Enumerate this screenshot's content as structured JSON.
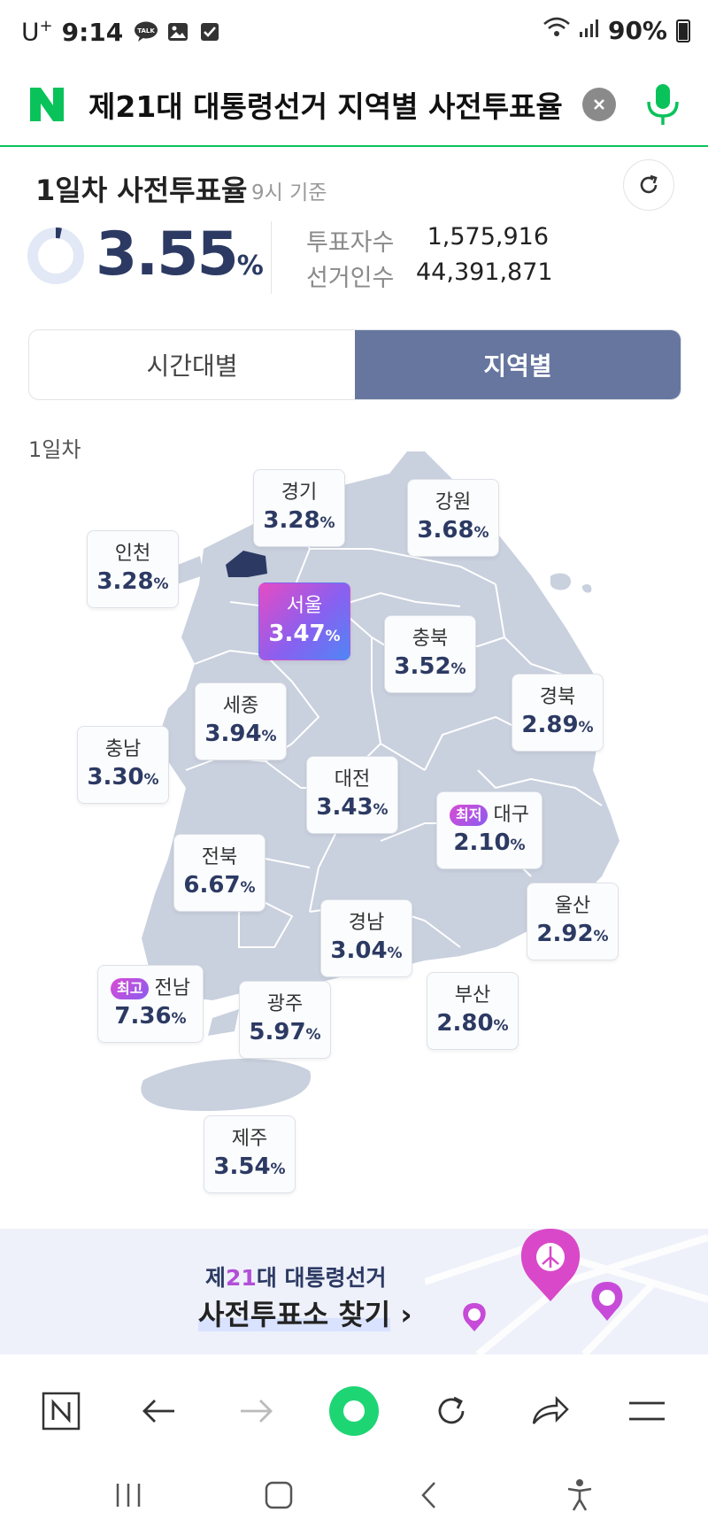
{
  "status_bar": {
    "carrier": "U",
    "carrier_sup": "+",
    "time": "9:14",
    "icons": [
      "talk-icon",
      "gallery-icon",
      "checkbox-icon"
    ],
    "battery": "90%"
  },
  "search": {
    "query": "제21대 대통령선거 지역별 사전투표율",
    "logo": "N"
  },
  "summary": {
    "title": "1일차 사전투표율",
    "basis": "9시 기준",
    "rate_value": "3.55",
    "rate_unit": "%",
    "voters_label": "투표자수",
    "voters_value": "1,575,916",
    "electorate_label": "선거인수",
    "electorate_value": "44,391,871"
  },
  "tabs": [
    {
      "label": "시간대별",
      "active": false
    },
    {
      "label": "지역별",
      "active": true
    }
  ],
  "map": {
    "day_label": "1일차",
    "regions": {
      "gyeonggi": {
        "name": "경기",
        "value": "3.28"
      },
      "gangwon": {
        "name": "강원",
        "value": "3.68"
      },
      "incheon": {
        "name": "인천",
        "value": "3.28"
      },
      "seoul": {
        "name": "서울",
        "value": "3.47"
      },
      "chungbuk": {
        "name": "충북",
        "value": "3.52"
      },
      "gyeongbuk": {
        "name": "경북",
        "value": "2.89"
      },
      "sejong": {
        "name": "세종",
        "value": "3.94"
      },
      "chungnam": {
        "name": "충남",
        "value": "3.30"
      },
      "daejeon": {
        "name": "대전",
        "value": "3.43"
      },
      "daegu": {
        "name": "대구",
        "value": "2.10",
        "badge": "최저"
      },
      "jeonbuk": {
        "name": "전북",
        "value": "6.67"
      },
      "ulsan": {
        "name": "울산",
        "value": "2.92"
      },
      "gyeongnam": {
        "name": "경남",
        "value": "3.04"
      },
      "jeonnam": {
        "name": "전남",
        "value": "7.36",
        "badge": "최고"
      },
      "gwangju": {
        "name": "광주",
        "value": "5.97"
      },
      "busan": {
        "name": "부산",
        "value": "2.80"
      },
      "jeju": {
        "name": "제주",
        "value": "3.54"
      }
    },
    "unit": "%",
    "colors": {
      "map_fill": "#c9d0de",
      "seoul_fill": "#2c3a63",
      "value_text": "#2c3a63"
    }
  },
  "banner": {
    "line1_prefix": "제",
    "line1_num": "21",
    "line1_suffix": "대 대통령선거",
    "line2": "사전투표소 찾기",
    "arrow": "›"
  },
  "toolbar": {
    "items": [
      "naver-home-icon",
      "back-icon",
      "forward-icon",
      "green-dot-icon",
      "reload-icon",
      "share-icon",
      "menu-icon"
    ]
  },
  "system_nav": {
    "items": [
      "recent-apps-icon",
      "home-icon",
      "back-icon",
      "accessibility-icon"
    ]
  },
  "colors": {
    "accent_green": "#09c35a",
    "tab_active": "#66769f",
    "dark_navy": "#2c3a63"
  }
}
